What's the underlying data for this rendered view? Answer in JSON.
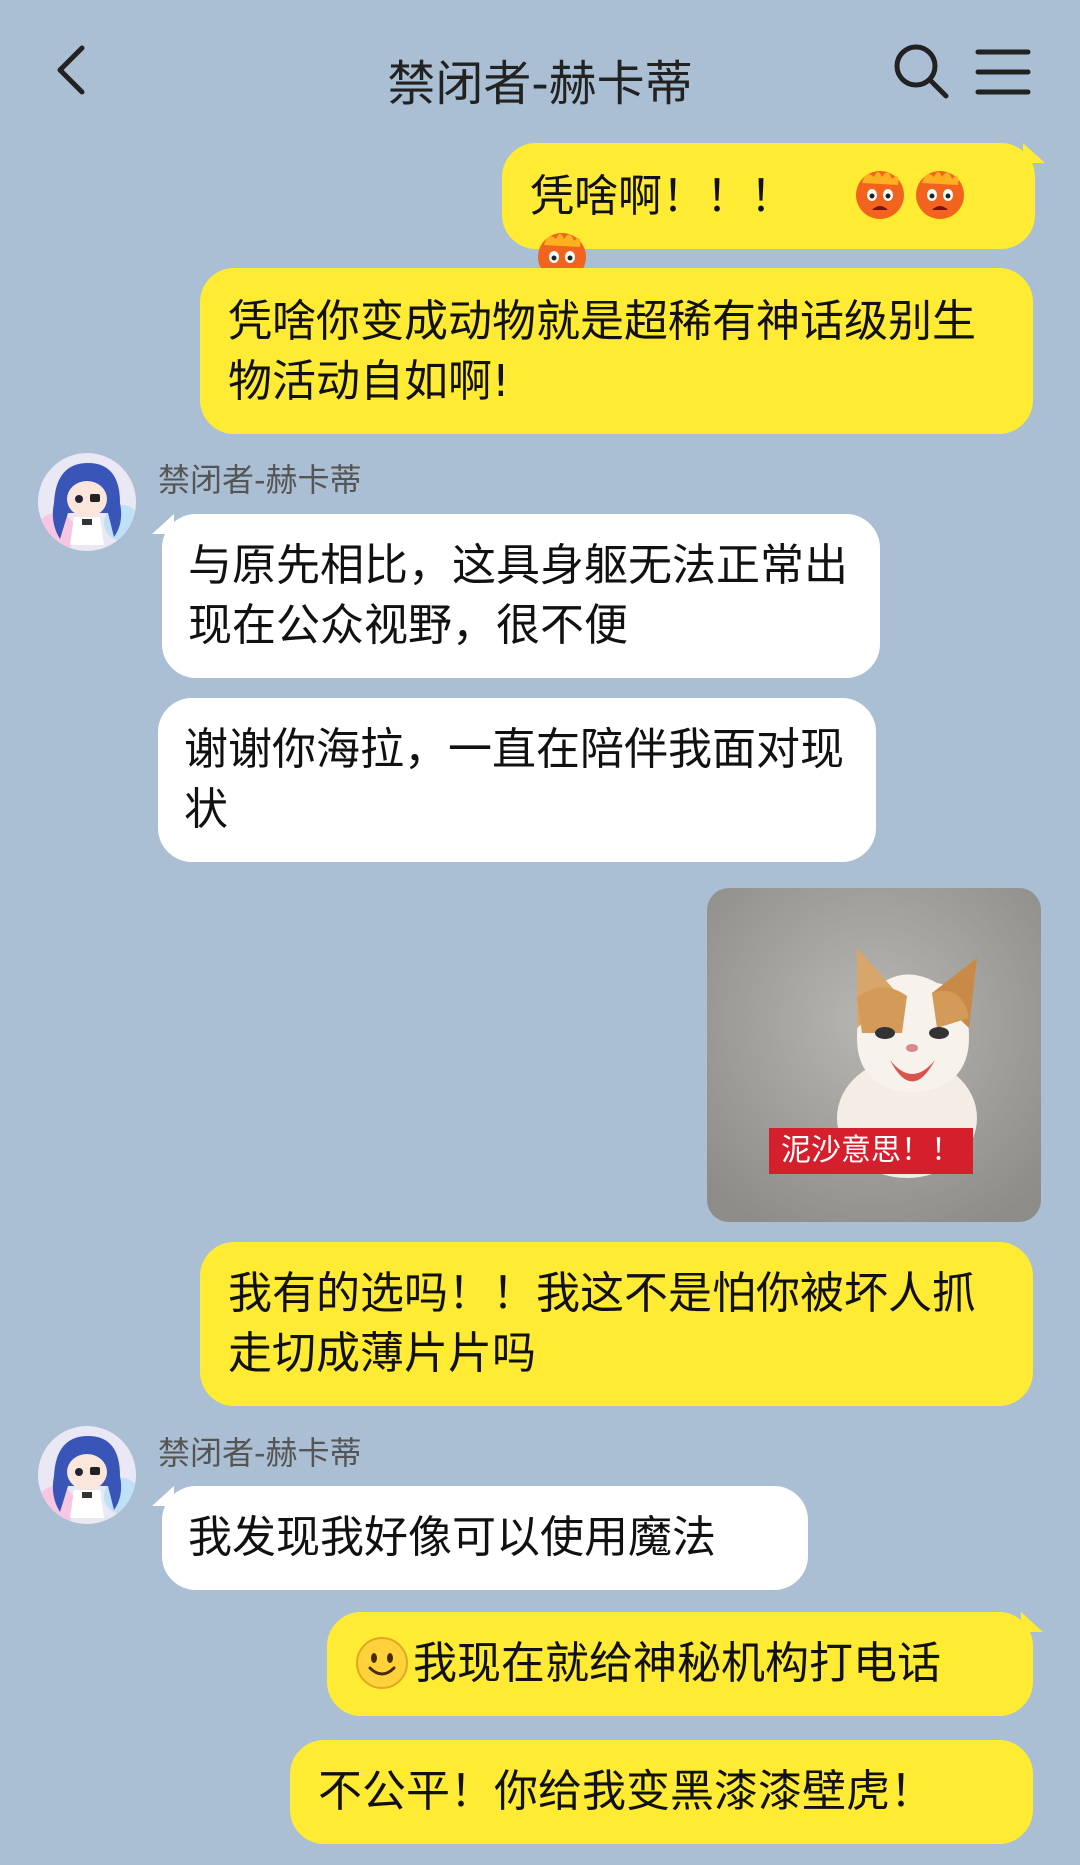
{
  "header": {
    "title": "禁闭者-赫卡蒂",
    "back_icon": "chevron-left-icon",
    "search_icon": "search-icon",
    "menu_icon": "hamburger-menu-icon"
  },
  "messages": [
    {
      "from": "me",
      "text": "凭啥啊！！！",
      "emoji": "angry-face-emoji x3"
    },
    {
      "from": "me",
      "text": "凭啥你变成动物就是超稀有神话级别生物活动自如啊!"
    },
    {
      "from": "them",
      "sender": "禁闭者-赫卡蒂",
      "text": "与原先相比，这具身躯无法正常出现在公众视野，很不便"
    },
    {
      "from": "them",
      "text": "谢谢你海拉，一直在陪伴我面对现状"
    },
    {
      "from": "me",
      "type": "image",
      "caption": "泥沙意思！！"
    },
    {
      "from": "me",
      "text": "我有的选吗！！我这不是怕你被坏人抓走切成薄片片吗"
    },
    {
      "from": "them",
      "sender": "禁闭者-赫卡蒂",
      "text": "我发现我好像可以使用魔法"
    },
    {
      "from": "me",
      "text": "我现在就给神秘机构打电话",
      "emoji": "smiley-emoji"
    },
    {
      "from": "me",
      "text": "不公平！你给我变黑漆漆壁虎！"
    }
  ],
  "colors": {
    "background": "#aabfd3",
    "my_bubble": "#ffeb34",
    "their_bubble": "#ffffff",
    "caption_bg": "#d51f2c"
  }
}
